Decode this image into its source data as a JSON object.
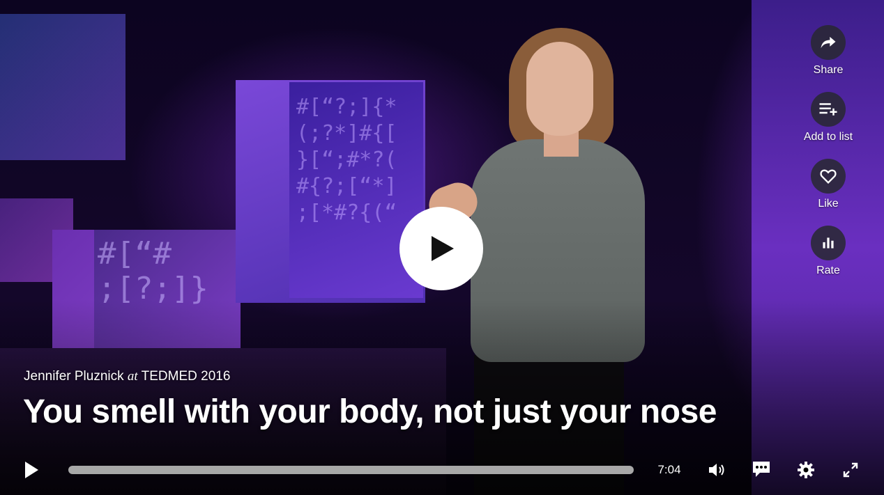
{
  "video": {
    "speaker": "Jennifer Pluznick",
    "at_word": "at",
    "event": "TEDMED 2016",
    "title": "You smell with your body, not just your nose"
  },
  "actions": [
    {
      "label": "Share",
      "icon": "share-icon"
    },
    {
      "label": "Add to list",
      "icon": "playlist-add-icon"
    },
    {
      "label": "Like",
      "icon": "heart-icon"
    },
    {
      "label": "Rate",
      "icon": "bar-chart-icon"
    }
  ],
  "controls": {
    "duration": "7:04",
    "progress_fraction": 0
  },
  "colors": {
    "accent": "#ffffff",
    "track": "#a8a8a8"
  }
}
